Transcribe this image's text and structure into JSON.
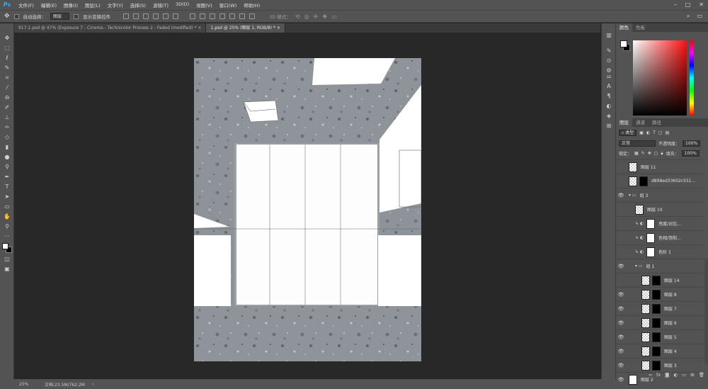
{
  "app": {
    "logo": "Ps"
  },
  "menu": [
    "文件(F)",
    "编辑(E)",
    "图像(I)",
    "图层(L)",
    "文字(Y)",
    "选择(S)",
    "滤镜(T)",
    "3D(D)",
    "视图(V)",
    "窗口(W)",
    "帮助(H)"
  ],
  "options": {
    "auto_select_label": "自动选择：",
    "auto_select_value": "图层",
    "show_transform_label": "显示变换控件",
    "mode_3d_label": "3D 模式："
  },
  "tabs": [
    {
      "label": "917-1.psd @ 47% (Exposure 7 - Cinema - Technicolor Process 2 - Faded (modified) *",
      "active": false
    },
    {
      "label": "1.psd @ 25% (图层 1, RGB/8) *",
      "active": true
    }
  ],
  "color_panel": {
    "tab_color": "颜色",
    "tab_swatches": "色板"
  },
  "layers_panel": {
    "tab_layers": "图层",
    "tab_channels": "通道",
    "tab_paths": "路径",
    "filter_kind": "类型",
    "blend_mode": "正常",
    "opacity_label": "不透明度：",
    "opacity_value": "100%",
    "lock_label": "锁定：",
    "fill_label": "填充：",
    "fill_value": "100%",
    "layers": [
      {
        "name": "图层 11",
        "visible": false,
        "thumb": "checker",
        "indent": 0
      },
      {
        "name": "d898ed33602c551...",
        "visible": false,
        "thumb": "checker",
        "indent": 0
      },
      {
        "name": "组 3",
        "visible": true,
        "thumb": "folder",
        "indent": 0
      },
      {
        "name": "图层 10",
        "visible": false,
        "thumb": "checker",
        "indent": 1
      },
      {
        "name": "亮度/对比...",
        "visible": false,
        "thumb": "adjust",
        "indent": 1
      },
      {
        "name": "色相/饱和...",
        "visible": false,
        "thumb": "adjust",
        "indent": 1
      },
      {
        "name": "色阶 1",
        "visible": false,
        "thumb": "adjust",
        "indent": 1
      },
      {
        "name": "组 1",
        "visible": true,
        "thumb": "folder",
        "indent": 1
      },
      {
        "name": "图层 14",
        "visible": false,
        "thumb": "checker",
        "indent": 2
      },
      {
        "name": "图层 8",
        "visible": true,
        "thumb": "checker",
        "indent": 2
      },
      {
        "name": "图层 7",
        "visible": true,
        "thumb": "checker",
        "indent": 2
      },
      {
        "name": "图层 6",
        "visible": true,
        "thumb": "checker",
        "indent": 2
      },
      {
        "name": "图层 5",
        "visible": true,
        "thumb": "checker",
        "indent": 2
      },
      {
        "name": "图层 4",
        "visible": true,
        "thumb": "checker",
        "indent": 2
      },
      {
        "name": "图层 3",
        "visible": true,
        "thumb": "checker",
        "indent": 2
      },
      {
        "name": "图层 2",
        "visible": true,
        "thumb": "white",
        "indent": 0
      }
    ]
  },
  "status": {
    "zoom": "25%",
    "doc_size": "文档:23.5M/762.2M"
  }
}
